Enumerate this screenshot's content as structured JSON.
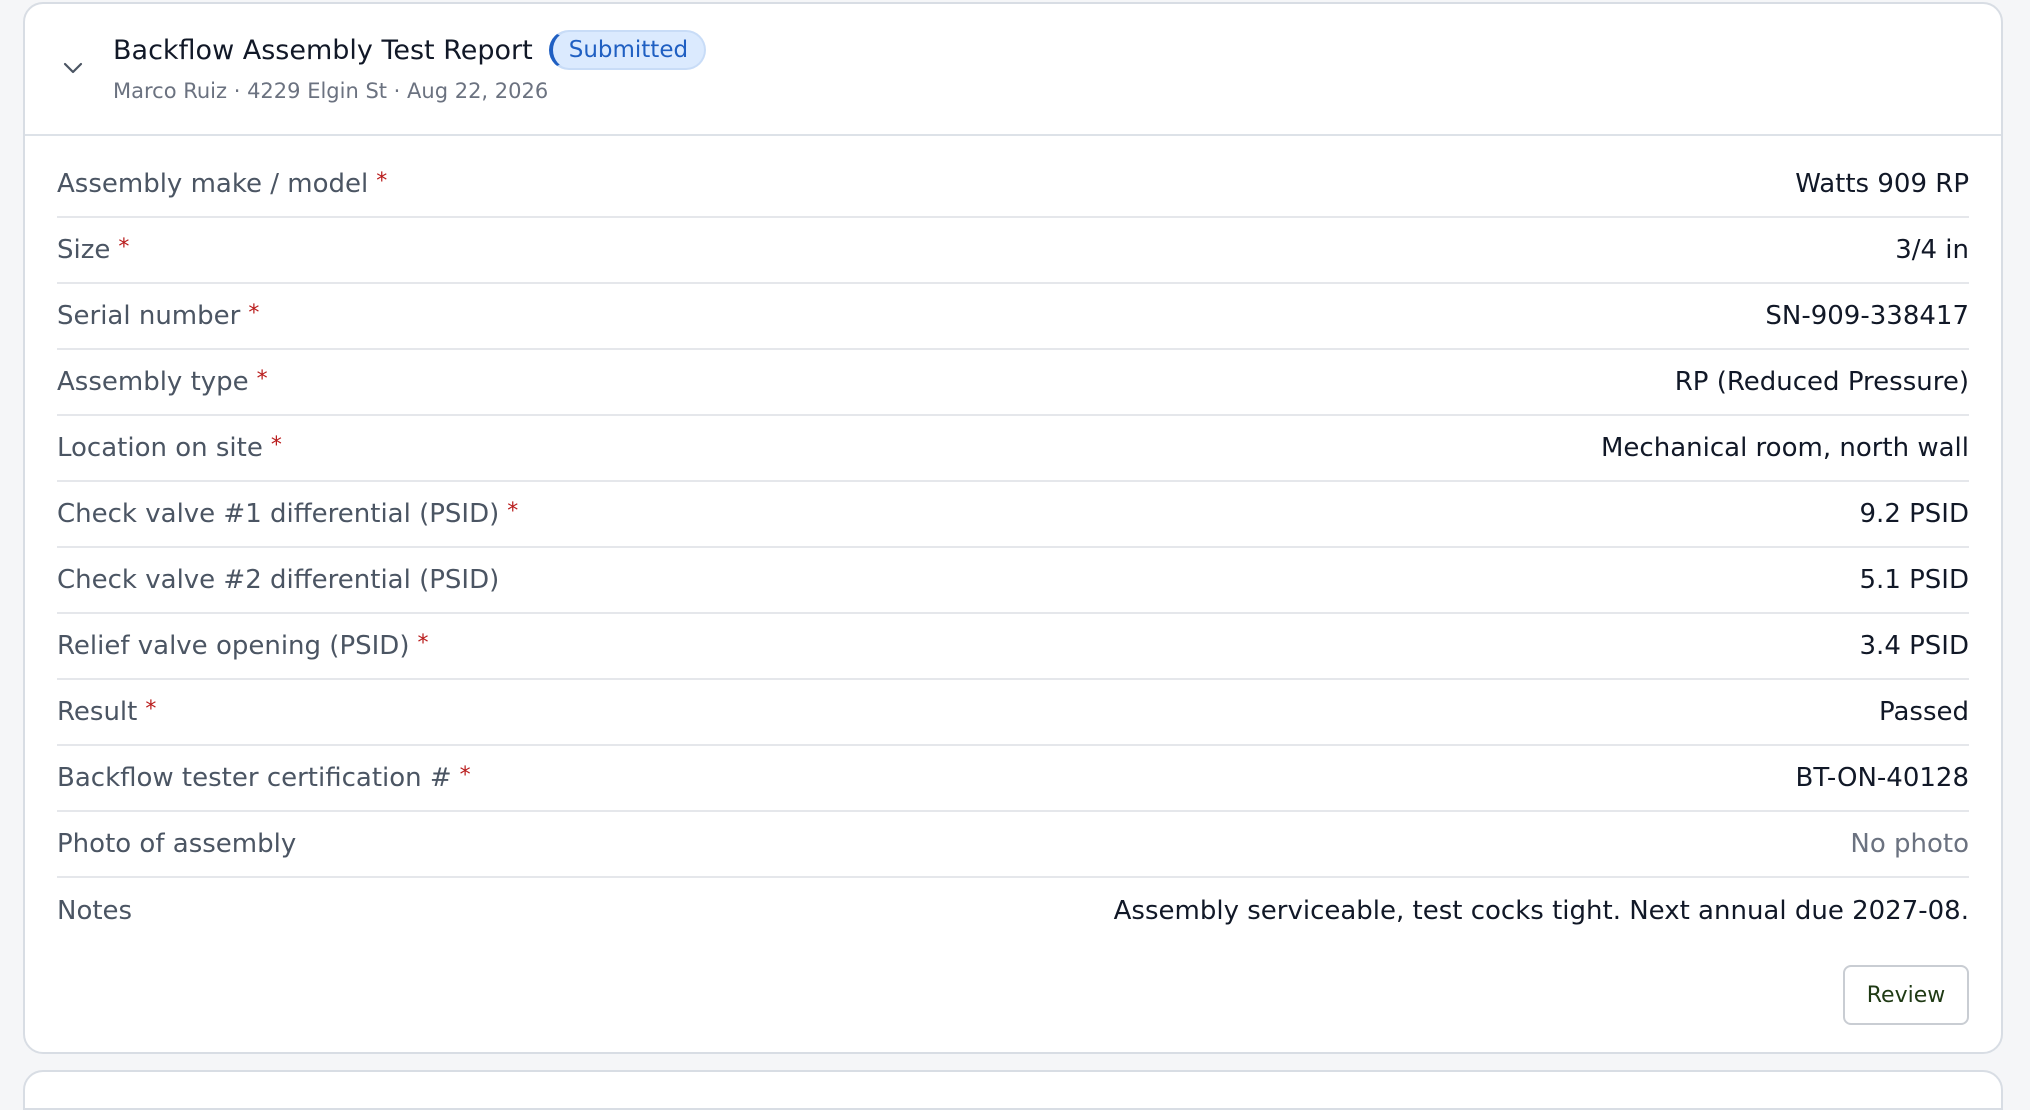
{
  "report": {
    "title": "Backflow Assembly Test Report",
    "status": "Submitted",
    "subtitle": "Marco Ruiz · 4229 Elgin St · Aug 22, 2026",
    "required_marker": "*",
    "fields": [
      {
        "label": "Assembly make / model",
        "value": "Watts 909 RP",
        "required": true
      },
      {
        "label": "Size",
        "value": "3/4 in",
        "required": true
      },
      {
        "label": "Serial number",
        "value": "SN-909-338417",
        "required": true
      },
      {
        "label": "Assembly type",
        "value": "RP (Reduced Pressure)",
        "required": true
      },
      {
        "label": "Location on site",
        "value": "Mechanical room, north wall",
        "required": true
      },
      {
        "label": "Check valve #1 differential (PSID)",
        "value": "9.2 PSID",
        "required": true
      },
      {
        "label": "Check valve #2 differential (PSID)",
        "value": "5.1 PSID",
        "required": false
      },
      {
        "label": "Relief valve opening (PSID)",
        "value": "3.4 PSID",
        "required": true
      },
      {
        "label": "Result",
        "value": "Passed",
        "required": true
      },
      {
        "label": "Backflow tester certification #",
        "value": "BT-ON-40128",
        "required": true
      },
      {
        "label": "Photo of assembly",
        "value": "No photo",
        "required": false
      },
      {
        "label": "Notes",
        "value": "Assembly serviceable, test cocks tight. Next annual due 2027-08.",
        "required": false
      }
    ],
    "review_label": "Review"
  },
  "icons": {
    "collapse": "chevron-down-icon"
  },
  "colors": {
    "status_badge_text": "#1f5fc2",
    "status_badge_bg": "#dbeafe",
    "required_marker": "#b91c1c"
  }
}
